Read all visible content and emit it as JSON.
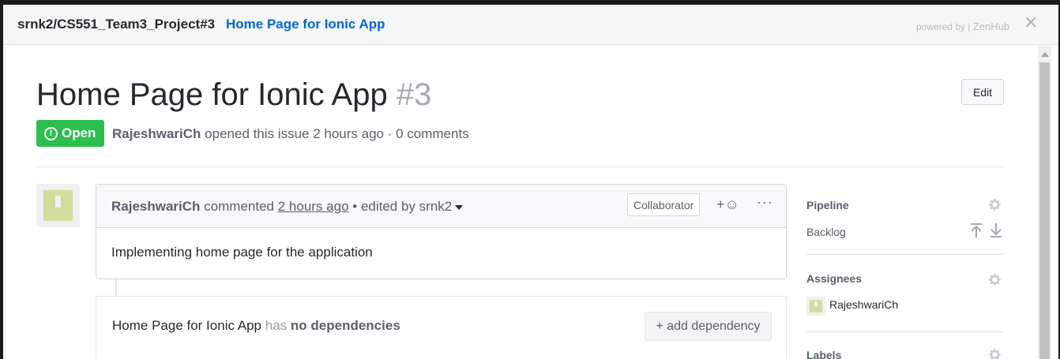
{
  "topbar": {
    "repo": "srnk2/CS551_Team3_Project#3",
    "issue_title": "Home Page for Ionic App",
    "powered_prefix": "powered by |",
    "powered_brand": "ZenHub",
    "close": "✕"
  },
  "issue": {
    "title": "Home Page for Ionic App",
    "number": "#3",
    "edit_label": "Edit",
    "state": "Open",
    "author": "RajeshwariCh",
    "opened_text": "opened this issue 2 hours ago · 0 comments"
  },
  "comment": {
    "author": "RajeshwariCh",
    "action": "commented",
    "time": "2 hours ago",
    "edited": "• edited by srnk2",
    "role": "Collaborator",
    "reaction": "+☺",
    "more": "···",
    "body": "Implementing home page for the application"
  },
  "dependencies": {
    "issue": "Home Page for Ionic App",
    "has": "has",
    "status": "no dependencies",
    "add_label": "+ add dependency"
  },
  "sidebar": {
    "pipeline_label": "Pipeline",
    "pipeline_value": "Backlog",
    "assignees_label": "Assignees",
    "assignee": "RajeshwariCh",
    "labels_label": "Labels"
  }
}
